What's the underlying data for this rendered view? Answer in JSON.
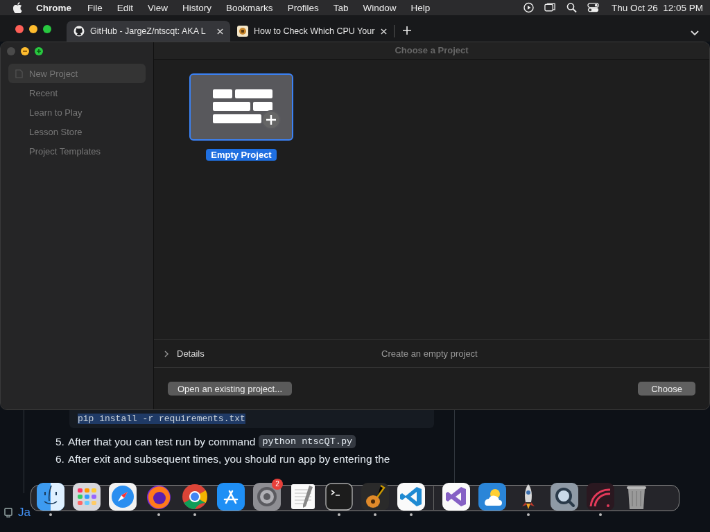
{
  "menu_bar": {
    "app": "Chrome",
    "menus": [
      "File",
      "Edit",
      "View",
      "History",
      "Bookmarks",
      "Profiles",
      "Tab",
      "Window",
      "Help"
    ],
    "clock": "Thu Oct 26  12:05 PM"
  },
  "browser_tabs": [
    {
      "title": "GitHub - JargeZ/ntscqt: AKA L",
      "selected": true
    },
    {
      "title": "How to Check Which CPU Your",
      "selected": false
    }
  ],
  "dialog": {
    "title": "Choose a Project",
    "sidebar": {
      "items": [
        {
          "label": "New Project",
          "selected": true
        },
        {
          "label": "Recent",
          "selected": false
        },
        {
          "label": "Learn to Play",
          "selected": false
        },
        {
          "label": "Lesson Store",
          "selected": false
        },
        {
          "label": "Project Templates",
          "selected": false
        }
      ]
    },
    "templates": [
      {
        "label": "Empty Project",
        "selected": true
      }
    ],
    "details": {
      "label": "Details",
      "expanded": false,
      "description": "Create an empty project"
    },
    "buttons": [
      {
        "kind": "secondary",
        "label": "Open an existing project..."
      },
      {
        "kind": "primary",
        "label": "Choose"
      }
    ]
  },
  "page": {
    "code_block": "pip install -r requirements.txt",
    "steps": [
      {
        "number": "5.",
        "text": "After that you can test run by command",
        "code": "python ntscQT.py"
      },
      {
        "number": "6.",
        "text": "After exit and subsequent times, you should run app by entering the"
      }
    ],
    "footer_link": "Ja"
  },
  "dock": {
    "items": [
      {
        "kind": "finder",
        "running": true
      },
      {
        "kind": "launchpad",
        "running": false
      },
      {
        "kind": "safari",
        "running": false
      },
      {
        "kind": "firefox",
        "running": true
      },
      {
        "kind": "chrome",
        "running": true
      },
      {
        "kind": "appstore",
        "running": false
      },
      {
        "kind": "settings",
        "running": false,
        "badge": "2"
      },
      {
        "kind": "textedit",
        "running": false
      },
      {
        "kind": "terminal",
        "running": true
      },
      {
        "kind": "guitar",
        "running": true
      },
      {
        "kind": "vscode",
        "running": true
      },
      {
        "kind": "divider"
      },
      {
        "kind": "visualstudio",
        "running": false
      },
      {
        "kind": "weather",
        "running": false
      },
      {
        "kind": "rocket",
        "running": true
      },
      {
        "kind": "quicktime",
        "running": false
      },
      {
        "kind": "recorder",
        "running": true
      },
      {
        "kind": "trash",
        "running": false
      }
    ]
  }
}
